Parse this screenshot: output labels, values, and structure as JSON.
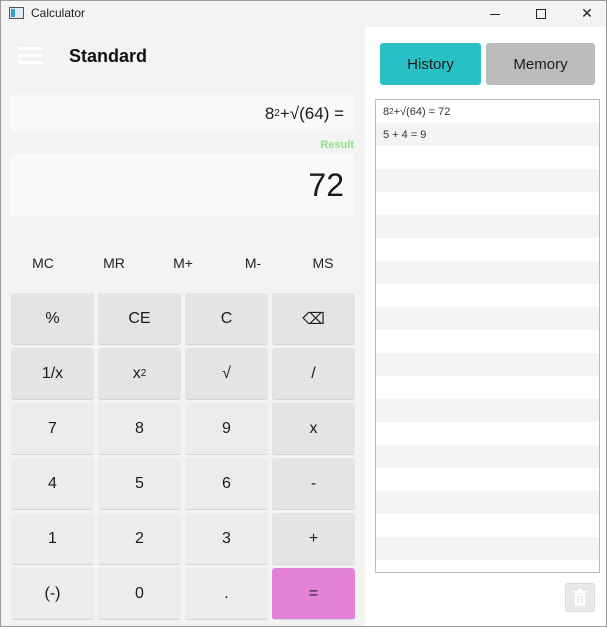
{
  "window": {
    "title": "Calculator",
    "icon": "calculator-app-icon",
    "controls": [
      "minimize-icon",
      "maximize-icon",
      "close-icon"
    ],
    "close_glyph": "✕"
  },
  "calculator": {
    "mode": "Standard",
    "expression": {
      "base": "8",
      "exp": "2",
      "rest": " +√(64) ="
    },
    "result_label": "Result",
    "result": "72",
    "memory_buttons": [
      "MC",
      "MR",
      "M+",
      "M-",
      "MS"
    ],
    "keys": [
      {
        "label": "%",
        "type": "fn"
      },
      {
        "label": "CE",
        "type": "fn"
      },
      {
        "label": "C",
        "type": "fn"
      },
      {
        "label": "⌫",
        "type": "fn"
      },
      {
        "label": "1/x",
        "type": "fn"
      },
      {
        "label": "x",
        "sup": "2",
        "type": "fn"
      },
      {
        "label": "√",
        "type": "fn"
      },
      {
        "label": "/",
        "type": "fn"
      },
      {
        "label": "7",
        "type": "num"
      },
      {
        "label": "8",
        "type": "num"
      },
      {
        "label": "9",
        "type": "num"
      },
      {
        "label": "x",
        "type": "fn"
      },
      {
        "label": "4",
        "type": "num"
      },
      {
        "label": "5",
        "type": "num"
      },
      {
        "label": "6",
        "type": "num"
      },
      {
        "label": "-",
        "type": "fn"
      },
      {
        "label": "1",
        "type": "num"
      },
      {
        "label": "2",
        "type": "num"
      },
      {
        "label": "3",
        "type": "num"
      },
      {
        "label": "+",
        "type": "fn"
      },
      {
        "label": "(-)",
        "type": "num"
      },
      {
        "label": "0",
        "type": "num"
      },
      {
        "label": ".",
        "type": "num"
      },
      {
        "label": "=",
        "type": "equals"
      }
    ]
  },
  "side_panel": {
    "tabs": [
      "History",
      "Memory"
    ],
    "active_tab": "History",
    "history": [
      {
        "base": "8",
        "exp": "2",
        "rest": " +√(64) = 72"
      },
      {
        "base": "",
        "exp": "",
        "rest": "5 + 4 = 9"
      }
    ],
    "empty_rows": 18,
    "clear_icon": "trash-icon"
  },
  "colors": {
    "history_tab": "#29c1c6",
    "memory_tab": "#bcbcbc",
    "equals_key": "#e582d8",
    "result_label": "#8ee08e"
  }
}
